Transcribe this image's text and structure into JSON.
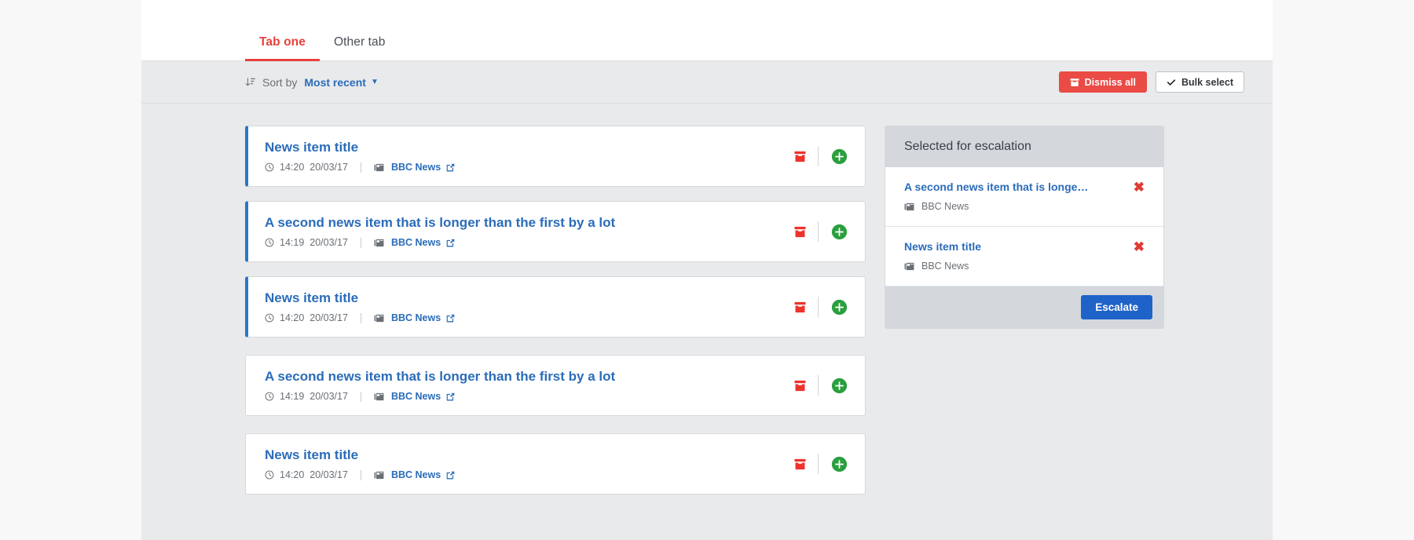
{
  "tabs": [
    {
      "label": "Tab one",
      "active": true
    },
    {
      "label": "Other tab",
      "active": false
    }
  ],
  "toolbar": {
    "sort_icon": "sort-descending-icon",
    "sort_label": "Sort by",
    "sort_value": "Most recent",
    "sort_chevron": "chevron-down-icon",
    "dismiss_all_label": "Dismiss all",
    "dismiss_all_icon": "archive-icon",
    "bulk_select_label": "Bulk select",
    "bulk_select_icon": "check-icon"
  },
  "feed": {
    "items": [
      {
        "title": "News item title",
        "time": "14:20",
        "date": "20/03/17",
        "source": "BBC News",
        "accent": true
      },
      {
        "title": "A second news item that is longer than the first by a lot",
        "time": "14:19",
        "date": "20/03/17",
        "source": "BBC News",
        "accent": true
      },
      {
        "title": "News item title",
        "time": "14:20",
        "date": "20/03/17",
        "source": "BBC News",
        "accent": true
      },
      {
        "title": "A second news item that is longer than the first by a lot",
        "time": "14:19",
        "date": "20/03/17",
        "source": "BBC News",
        "accent": false
      },
      {
        "title": "News item title",
        "time": "14:20",
        "date": "20/03/17",
        "source": "BBC News",
        "accent": false
      }
    ]
  },
  "panel": {
    "title": "Selected for escalation",
    "rows": [
      {
        "title": "A second news item that is longe…",
        "source": "BBC News",
        "remove_icon": "close-icon"
      },
      {
        "title": "News item title",
        "source": "BBC News",
        "remove_icon": "close-icon"
      }
    ],
    "escalate_label": "Escalate"
  },
  "colors": {
    "accent_red": "#e8413c",
    "link_blue": "#2b6cb9",
    "accent_bar_blue": "#2b76cd",
    "primary_blue": "#1f63c8",
    "danger_red": "#ea4b45",
    "archive_red": "#ee322c",
    "add_green": "#2a9f3d",
    "remove_red": "#e03b34",
    "page_bg": "#f8f8f9",
    "content_bg": "#e9eaec",
    "panel_head_bg": "#d4d7dc",
    "card_bg": "#ffffff",
    "muted_text": "#6a6f75"
  }
}
